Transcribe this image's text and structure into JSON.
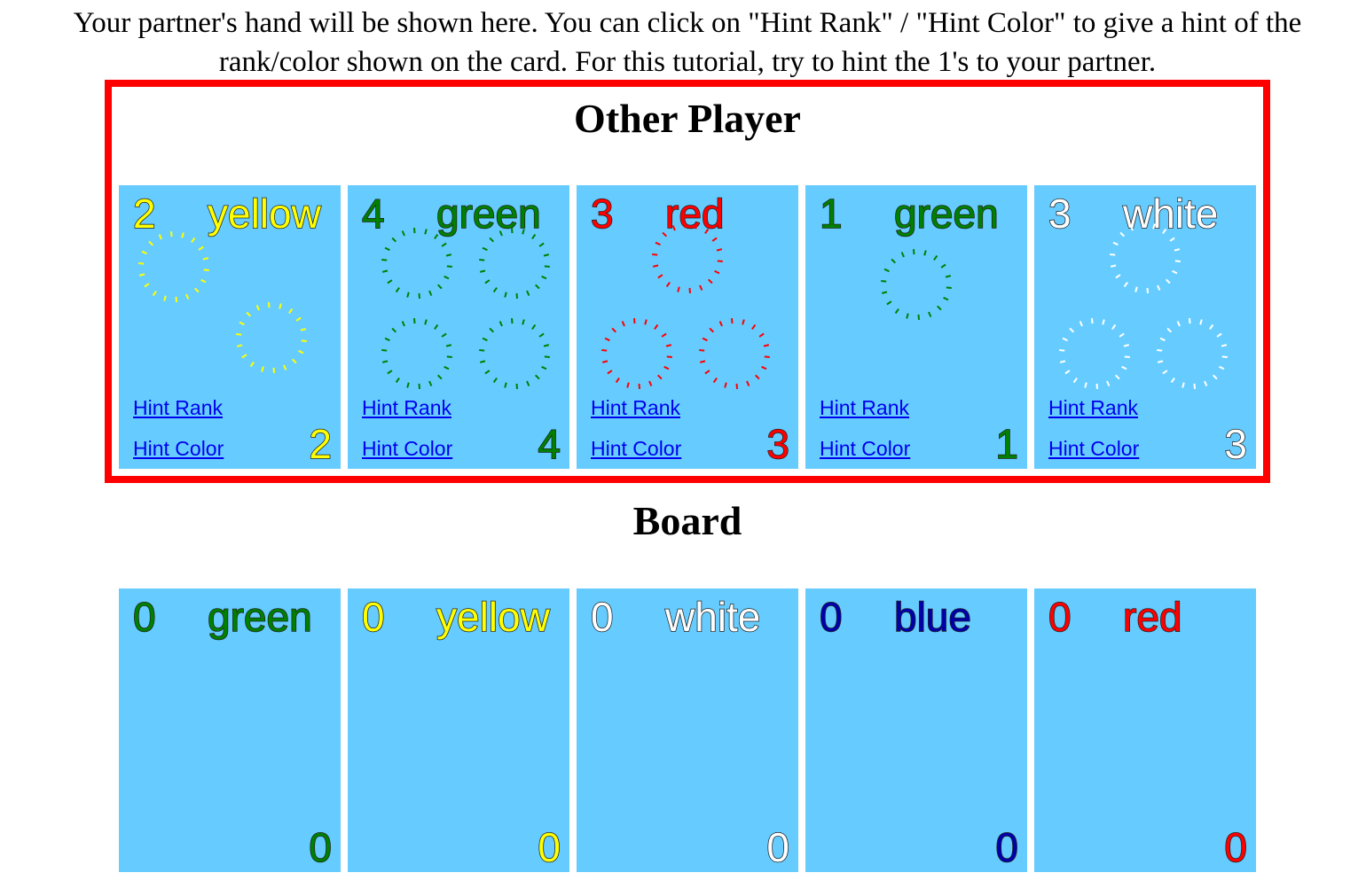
{
  "instructions": "Your partner's hand will be shown here. You can click on \"Hint Rank\" / \"Hint Color\" to give a hint of the rank/color shown on the card. For this tutorial, try to hint the 1's to your partner.",
  "other_player": {
    "title": "Other Player",
    "cards": [
      {
        "rank": "2",
        "color": "yellow",
        "color_hex": "#ffff00",
        "hint_rank": "Hint Rank",
        "hint_color": "Hint Color"
      },
      {
        "rank": "4",
        "color": "green",
        "color_hex": "#008000",
        "hint_rank": "Hint Rank",
        "hint_color": "Hint Color"
      },
      {
        "rank": "3",
        "color": "red",
        "color_hex": "#ff0000",
        "hint_rank": "Hint Rank",
        "hint_color": "Hint Color"
      },
      {
        "rank": "1",
        "color": "green",
        "color_hex": "#008000",
        "hint_rank": "Hint Rank",
        "hint_color": "Hint Color"
      },
      {
        "rank": "3",
        "color": "white",
        "color_hex": "#ffffff",
        "hint_rank": "Hint Rank",
        "hint_color": "Hint Color"
      }
    ]
  },
  "board": {
    "title": "Board",
    "cards": [
      {
        "rank": "0",
        "color": "green",
        "color_hex": "#008000"
      },
      {
        "rank": "0",
        "color": "yellow",
        "color_hex": "#ffff00"
      },
      {
        "rank": "0",
        "color": "white",
        "color_hex": "#ffffff"
      },
      {
        "rank": "0",
        "color": "blue",
        "color_hex": "#0000aa"
      },
      {
        "rank": "0",
        "color": "red",
        "color_hex": "#ff0000"
      }
    ]
  },
  "colors": {
    "card_background": "#66ccff",
    "panel_border": "#ff0000",
    "link": "#0000ee"
  },
  "icons": {
    "firework": "firework-icon"
  }
}
